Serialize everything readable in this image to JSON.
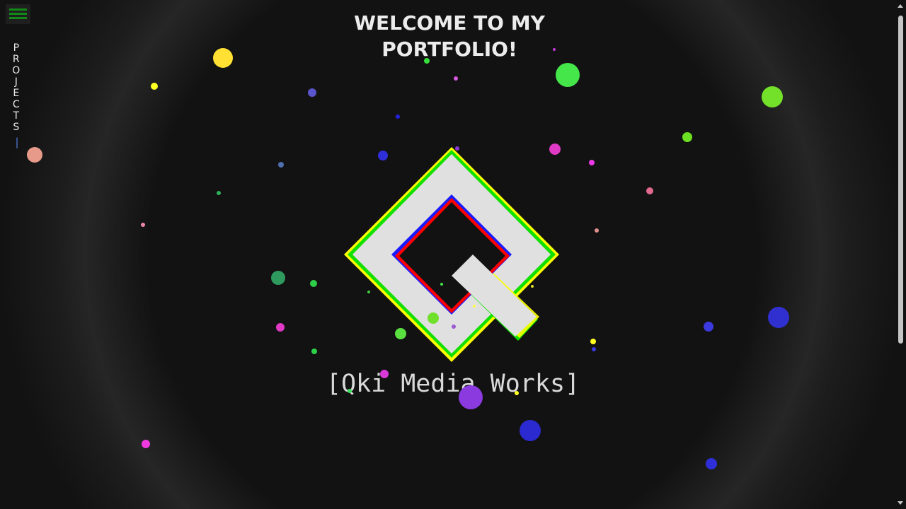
{
  "header": {
    "title_line1": "WELCOME TO MY",
    "title_line2": "PORTFOLIO!"
  },
  "sidebar": {
    "menu_icon": "hamburger-menu-icon",
    "projects_label": "PROJECTS",
    "projects_caret": "|"
  },
  "brand": {
    "name": "[Qki Media Works]"
  },
  "colors": {
    "background": "#121212",
    "menu_bars": "#118a18",
    "logo_fill": "#e0e0e0",
    "logo_outer_green": "#12e000",
    "logo_outer_yellow": "#ffff00",
    "logo_inner_red": "#ff0000",
    "logo_inner_blue": "#1a1aff",
    "caret": "#4e7bd9"
  }
}
